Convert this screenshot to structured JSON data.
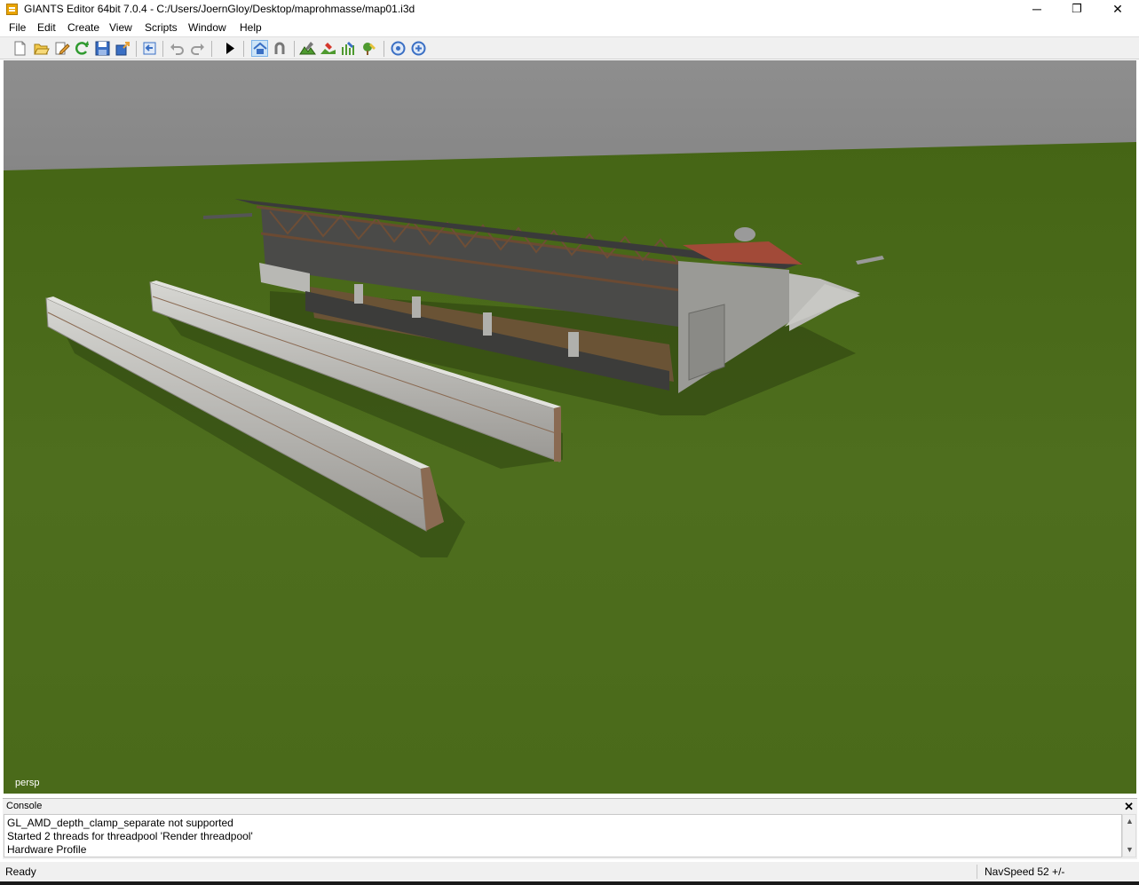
{
  "window": {
    "title": "GIANTS Editor 64bit 7.0.4 - C:/Users/JoernGloy/Desktop/maprohmasse/map01.i3d",
    "minimize": "─",
    "restore": "❐",
    "close": "✕"
  },
  "menu": {
    "items": [
      "File",
      "Edit",
      "Create",
      "View",
      "Scripts",
      "Window",
      "Help"
    ]
  },
  "toolbar": {
    "icons": [
      "new-icon",
      "open-icon",
      "edit-icon",
      "refresh-icon",
      "save-icon",
      "export-icon",
      "import-icon",
      "undo-icon",
      "redo-icon",
      "play-icon",
      "home-icon",
      "magnet-icon",
      "terrain-sculpt-icon",
      "terrain-paint-icon",
      "foliage-paint-icon",
      "tree-paint-icon",
      "gizmo-move-icon",
      "gizmo-rotate-icon"
    ]
  },
  "viewport": {
    "camera_label": "persp",
    "sky_color": "#8c8c8c",
    "ground_color": "#4b6a1c"
  },
  "console": {
    "title": "Console",
    "close": "✕",
    "lines": [
      "  GL_AMD_depth_clamp_separate not supported",
      "Started 2 threads for threadpool 'Render threadpool'",
      "Hardware Profile"
    ]
  },
  "status": {
    "left": "Ready",
    "right": "NavSpeed 52 +/-"
  }
}
